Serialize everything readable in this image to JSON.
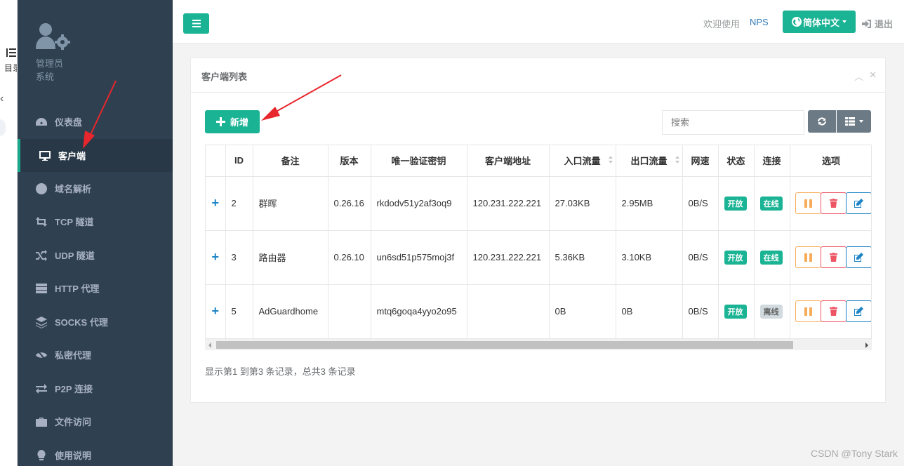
{
  "outer": {
    "label": "目录"
  },
  "profile": {
    "line1": "管理员",
    "line2": "系统"
  },
  "sidebar": {
    "items": [
      {
        "label": "仪表盘",
        "icon": "dashboard-icon"
      },
      {
        "label": "客户端",
        "icon": "desktop-icon",
        "active": true
      },
      {
        "label": "域名解析",
        "icon": "globe-icon"
      },
      {
        "label": "TCP 隧道",
        "icon": "retweet-icon"
      },
      {
        "label": "UDP 隧道",
        "icon": "random-icon"
      },
      {
        "label": "HTTP 代理",
        "icon": "server-icon"
      },
      {
        "label": "SOCKS 代理",
        "icon": "stack-icon"
      },
      {
        "label": "私密代理",
        "icon": "eye-slash-icon"
      },
      {
        "label": "P2P 连接",
        "icon": "exchange-icon"
      },
      {
        "label": "文件访问",
        "icon": "briefcase-icon"
      },
      {
        "label": "使用说明",
        "icon": "lightbulb-icon"
      }
    ]
  },
  "header": {
    "welcome": "欢迎使用",
    "brand": "NPS",
    "language": "简体中文",
    "logout": "退出"
  },
  "card": {
    "title": "客户端列表",
    "add_label": "新增",
    "search_placeholder": "搜索",
    "pagination": "显示第1 到第3 条记录，总共3 条记录"
  },
  "table": {
    "columns": [
      "",
      "ID",
      "备注",
      "版本",
      "唯一验证密钥",
      "客户端地址",
      "入口流量",
      "出口流量",
      "网速",
      "状态",
      "连接",
      "选项"
    ],
    "rows": [
      {
        "expand": "+",
        "id": "2",
        "remark": "群晖",
        "version": "0.26.16",
        "vkey": "rkdodv51y2af3oq9",
        "addr": "120.231.222.221",
        "in": "27.03KB",
        "out": "2.95MB",
        "speed": "0B/S",
        "status": "开放",
        "conn": "在线",
        "online": true
      },
      {
        "expand": "+",
        "id": "3",
        "remark": "路由器",
        "version": "0.26.10",
        "vkey": "un6sd51p575moj3f",
        "addr": "120.231.222.221",
        "in": "5.36KB",
        "out": "3.10KB",
        "speed": "0B/S",
        "status": "开放",
        "conn": "在线",
        "online": true
      },
      {
        "expand": "+",
        "id": "5",
        "remark": "AdGuardhome",
        "version": "",
        "vkey": "mtq6goqa4yyo2o95",
        "addr": "",
        "in": "0B",
        "out": "0B",
        "speed": "0B/S",
        "status": "开放",
        "conn": "离线",
        "online": false
      }
    ]
  },
  "watermark": "CSDN @Tony Stark",
  "colors": {
    "sidebar": "#2f4050",
    "accent": "#1ab394",
    "link": "#337ab7"
  }
}
